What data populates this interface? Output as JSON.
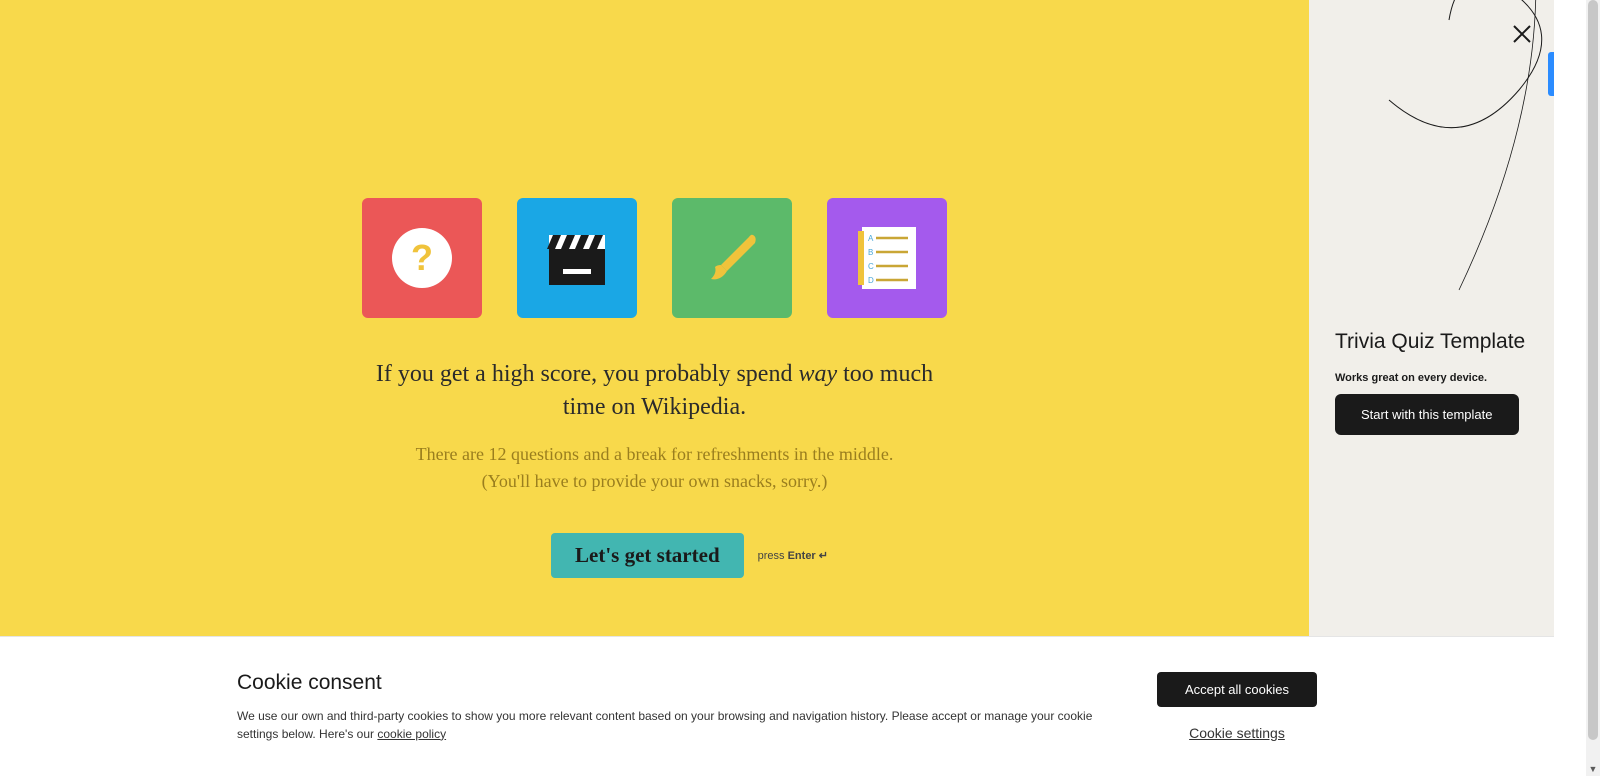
{
  "main": {
    "headline_before": "If you get a high score, you probably spend ",
    "headline_italic": "way",
    "headline_after": " too much time on Wikipedia.",
    "sub_line1": "There are 12 questions and a break for refreshments in the middle.",
    "sub_line2": "(You'll have to provide your own snacks, sorry.)",
    "cta_label": "Let's get started",
    "press_prefix": "press ",
    "press_key": "Enter ↵"
  },
  "icons": {
    "question": "question-mark-icon",
    "clapper": "clapperboard-icon",
    "brush": "paintbrush-icon",
    "list": "answer-list-icon"
  },
  "sidebar": {
    "title": "Trivia Quiz Template",
    "subtitle": "Works great on every device.",
    "start_label": "Start with this template"
  },
  "cookie": {
    "title": "Cookie consent",
    "text": "We use our own and third-party cookies to show you more relevant content based on your browsing and navigation history. Please accept or manage your cookie settings below. Here's our ",
    "link": "cookie policy",
    "accept_label": "Accept all cookies",
    "settings_label": "Cookie settings"
  }
}
